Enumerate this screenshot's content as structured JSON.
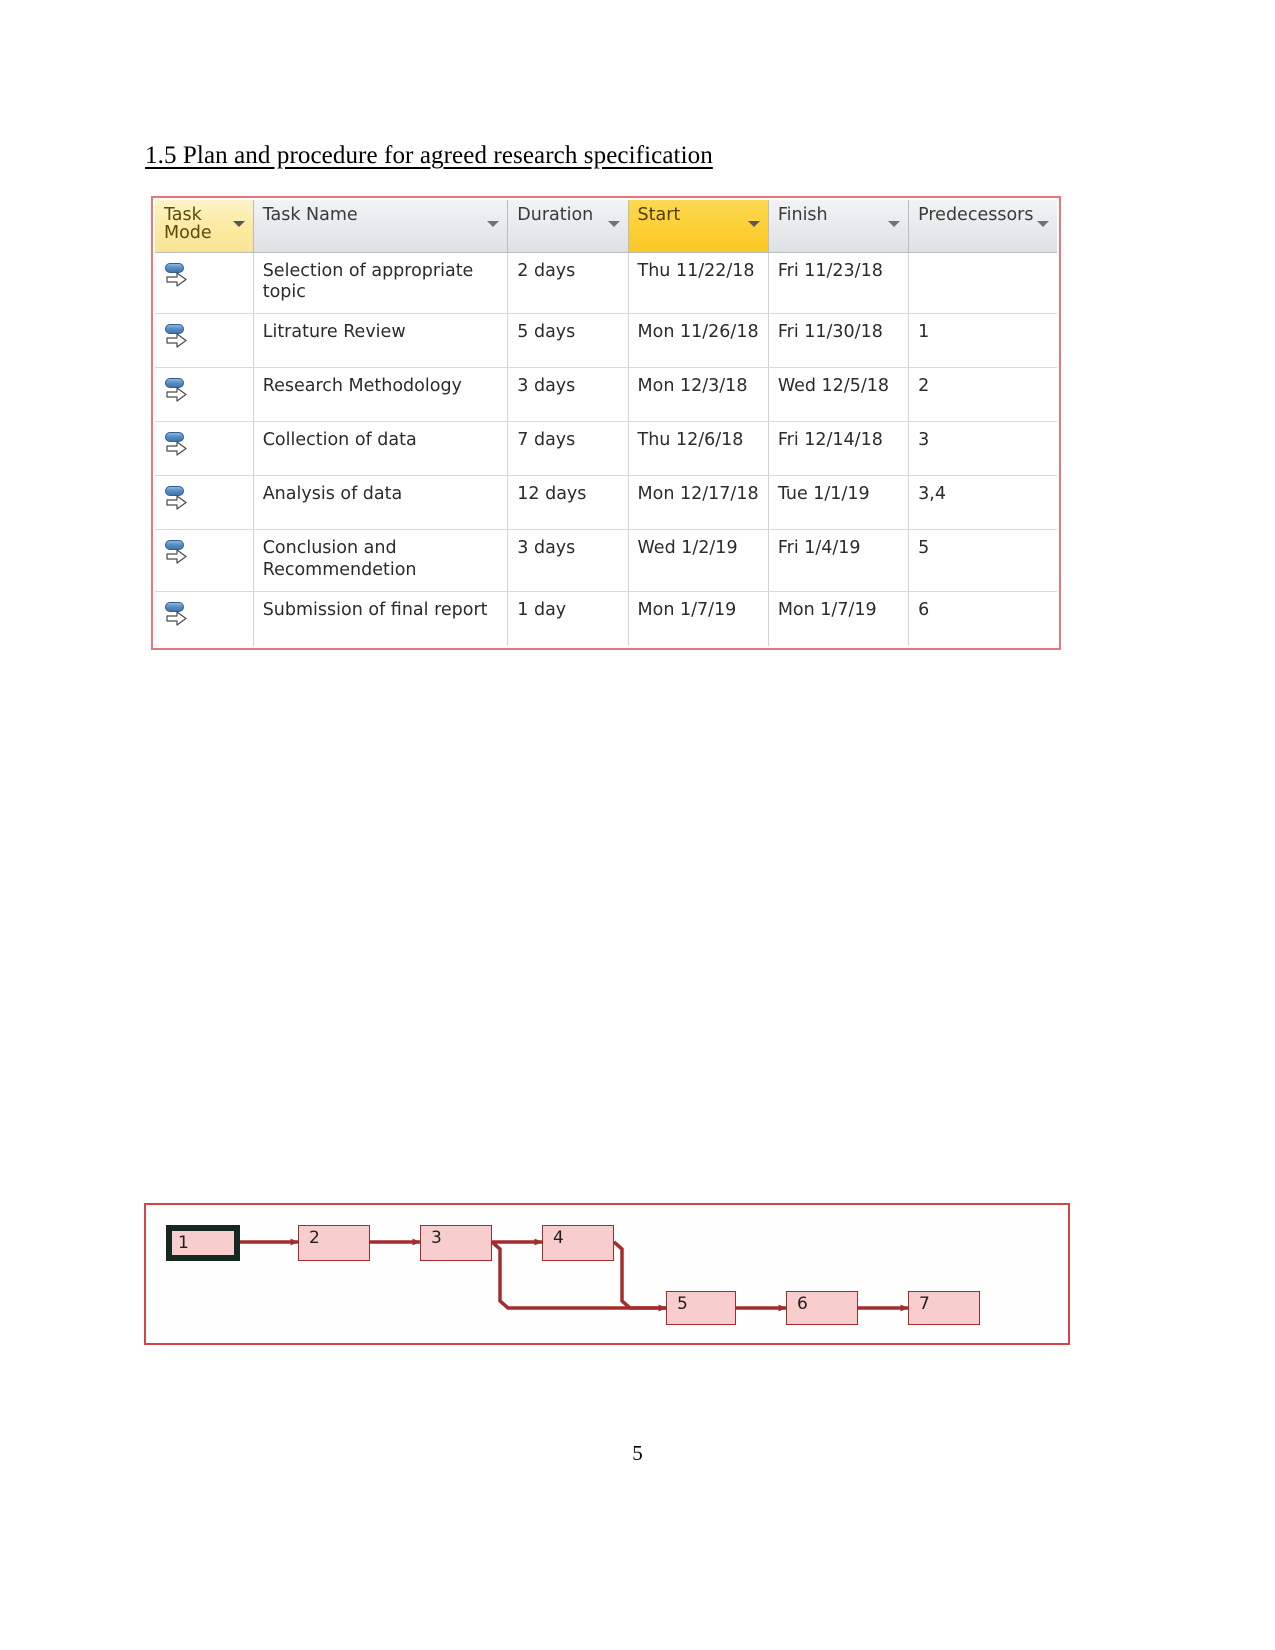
{
  "document": {
    "heading": "1.5 Plan and procedure for agreed research specification",
    "page_number": "5"
  },
  "task_table": {
    "columns": [
      {
        "key": "task_mode",
        "label": "Task Mode",
        "highlight": "soft"
      },
      {
        "key": "task_name",
        "label": "Task Name",
        "highlight": "none"
      },
      {
        "key": "duration",
        "label": "Duration",
        "highlight": "none"
      },
      {
        "key": "start",
        "label": "Start",
        "highlight": "strong"
      },
      {
        "key": "finish",
        "label": "Finish",
        "highlight": "none"
      },
      {
        "key": "predecessors",
        "label": "Predecessors",
        "highlight": "none"
      }
    ],
    "mode_icon": "auto-scheduled-icon",
    "rows": [
      {
        "id": "1",
        "mode": "auto-scheduled-icon",
        "name": "Selection of appropriate topic",
        "duration": "2 days",
        "start": "Thu 11/22/18",
        "finish": "Fri 11/23/18",
        "predecessors": ""
      },
      {
        "id": "2",
        "mode": "auto-scheduled-icon",
        "name": "Litrature Review",
        "duration": "5 days",
        "start": "Mon 11/26/18",
        "finish": "Fri 11/30/18",
        "predecessors": "1"
      },
      {
        "id": "3",
        "mode": "auto-scheduled-icon",
        "name": "Research Methodology",
        "duration": "3 days",
        "start": "Mon 12/3/18",
        "finish": "Wed 12/5/18",
        "predecessors": "2"
      },
      {
        "id": "4",
        "mode": "auto-scheduled-icon",
        "name": "Collection of data",
        "duration": "7 days",
        "start": "Thu 12/6/18",
        "finish": "Fri 12/14/18",
        "predecessors": "3"
      },
      {
        "id": "5",
        "mode": "auto-scheduled-icon",
        "name": "Analysis of data",
        "duration": "12 days",
        "start": "Mon 12/17/18",
        "finish": "Tue 1/1/19",
        "predecessors": "3,4"
      },
      {
        "id": "6",
        "mode": "auto-scheduled-icon",
        "name": "Conclusion and Recommendetion",
        "duration": "3 days",
        "start": "Wed 1/2/19",
        "finish": "Fri 1/4/19",
        "predecessors": "5"
      },
      {
        "id": "7",
        "mode": "auto-scheduled-icon",
        "name": "Submission of final report",
        "duration": "1 day",
        "start": "Mon 1/7/19",
        "finish": "Mon 1/7/19",
        "predecessors": "6"
      }
    ]
  },
  "network_diagram": {
    "nodes": [
      {
        "label": "1",
        "selected": true
      },
      {
        "label": "2",
        "selected": false
      },
      {
        "label": "3",
        "selected": false
      },
      {
        "label": "4",
        "selected": false
      },
      {
        "label": "5",
        "selected": false
      },
      {
        "label": "6",
        "selected": false
      },
      {
        "label": "7",
        "selected": false
      }
    ],
    "links": [
      {
        "from": "1",
        "to": "2"
      },
      {
        "from": "2",
        "to": "3"
      },
      {
        "from": "3",
        "to": "4"
      },
      {
        "from": "3",
        "to": "5"
      },
      {
        "from": "4",
        "to": "5"
      },
      {
        "from": "5",
        "to": "6"
      },
      {
        "from": "6",
        "to": "7"
      }
    ]
  },
  "colors": {
    "frame_border": "#d8424a",
    "node_fill": "#f7cdcd",
    "node_border": "#a32d2d",
    "link": "#a32d2d",
    "header_highlight_strong": "#fccf35",
    "header_highlight_soft": "#fbeaa0",
    "header_default": "#e7e9eb"
  }
}
